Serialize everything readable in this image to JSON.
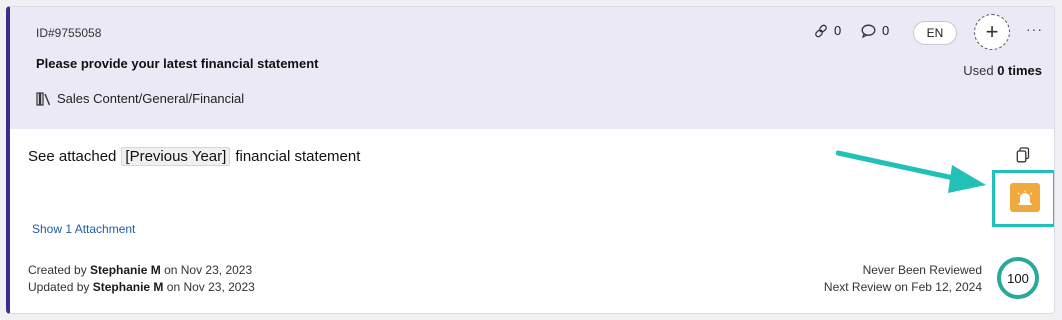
{
  "header": {
    "id": "ID#9755058",
    "question": "Please provide your latest financial statement",
    "path": "Sales Content/General/Financial",
    "links_count": "0",
    "comments_count": "0",
    "language": "EN",
    "add_label": "+",
    "more_label": "···",
    "used_prefix": "Used",
    "used_count": "0 times"
  },
  "answer": {
    "before": "See attached",
    "placeholder": "[Previous Year]",
    "after": "financial statement"
  },
  "attachments": {
    "link": "Show 1 Attachment"
  },
  "meta": {
    "created_prefix": "Created by",
    "created_by": "Stephanie M",
    "created_on": "on Nov 23, 2023",
    "updated_prefix": "Updated by",
    "updated_by": "Stephanie M",
    "updated_on": "on Nov 23, 2023"
  },
  "review": {
    "status": "Never Been Reviewed",
    "next": "Next Review on Feb 12, 2024",
    "score": "100"
  },
  "colors": {
    "accent": "#3b2f8c",
    "header_bg": "#ebe9f5",
    "alert": "#f0a93c",
    "highlight": "#22c1b8",
    "score_ring": "#2aa89b",
    "link": "#1f5fa8"
  },
  "icons": [
    "library-icon",
    "link-icon",
    "comment-icon",
    "copy-icon",
    "siren-icon",
    "arrow-annotation"
  ]
}
